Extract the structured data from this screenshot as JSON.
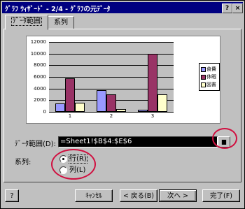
{
  "window": {
    "title": "ｸﾞﾗﾌ ｳｨｻﾞｰﾄﾞ - 2/4 - ｸﾞﾗﾌの元ﾃﾞｰﾀ",
    "help_btn": "?",
    "close_btn": "×"
  },
  "tabs": [
    {
      "label": "ﾃﾞｰﾀ範囲",
      "active": true
    },
    {
      "label": "系列",
      "active": false
    }
  ],
  "chart_data": {
    "type": "bar",
    "categories": [
      "1",
      "2",
      "3"
    ],
    "series": [
      {
        "name": "食費",
        "values": [
          1400,
          3700,
          400
        ],
        "color": "#9999ff"
      },
      {
        "name": "休暇",
        "values": [
          5700,
          3000,
          10000
        ],
        "color": "#993366"
      },
      {
        "name": "図書",
        "values": [
          1500,
          500,
          3000
        ],
        "color": "#ffffcc"
      }
    ],
    "ylim": [
      0,
      12000
    ],
    "yticks": [
      "0",
      "2000",
      "4000",
      "6000",
      "8000",
      "10000",
      "12000"
    ],
    "grid": true,
    "legend_position": "right"
  },
  "range": {
    "label": "ﾃﾞｰﾀ範囲(D):",
    "value": "=Sheet1!$B$4:$E$6"
  },
  "series_in": {
    "label": "系列:",
    "options": [
      {
        "label": "行(R)",
        "checked": true
      },
      {
        "label": "列(L)",
        "checked": false
      }
    ]
  },
  "buttons": {
    "help": "?",
    "cancel": "ｷｬﾝｾﾙ",
    "back": "< 戻る(B)",
    "next": "次へ >",
    "finish": "完了(F)"
  }
}
